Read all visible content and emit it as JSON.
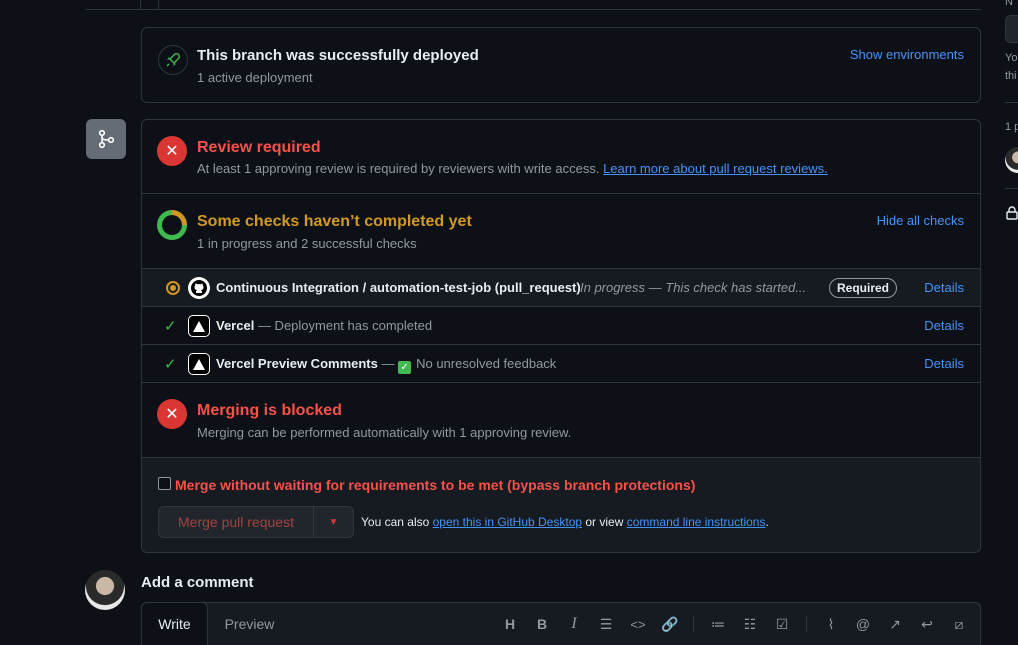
{
  "deployment": {
    "title": "This branch was successfully deployed",
    "subtitle": "1 active deployment",
    "show_environments": "Show environments"
  },
  "review": {
    "title": "Review required",
    "text": "At least 1 approving review is required by reviewers with write access. ",
    "link": "Learn more about pull request reviews."
  },
  "checks": {
    "title": "Some checks haven’t completed yet",
    "subtitle": "1 in progress and 2 successful checks",
    "hide_all": "Hide all checks",
    "items": [
      {
        "name": "Continuous Integration / automation-test-job (pull_request)",
        "status": "In progress — This check has started...",
        "badge": "Required",
        "details": "Details"
      },
      {
        "name": "Vercel",
        "status": " — Deployment has completed",
        "details": "Details"
      },
      {
        "name": "Vercel Preview Comments",
        "status_prefix": " — ",
        "status": "No unresolved feedback",
        "details": "Details"
      }
    ]
  },
  "blocked": {
    "title": "Merging is blocked",
    "subtitle": "Merging can be performed automatically with 1 approving review."
  },
  "bypass": {
    "label": "Merge without waiting for requirements to be met (bypass branch protections)",
    "merge_button": "Merge pull request",
    "also_text": "You can also ",
    "desktop_link": "open this in GitHub Desktop",
    "or_view": " or view ",
    "cli_link": "command line instructions",
    "period": "."
  },
  "comment": {
    "heading": "Add a comment",
    "tab_write": "Write",
    "tab_preview": "Preview"
  },
  "sidebar": {
    "frag1": "N",
    "frag2": "Yo",
    "frag3": "thi",
    "frag4": "1 p"
  },
  "colors": {
    "accent": "#4493f8",
    "danger": "#f85149",
    "warning": "#d29922",
    "success": "#3fb950"
  }
}
